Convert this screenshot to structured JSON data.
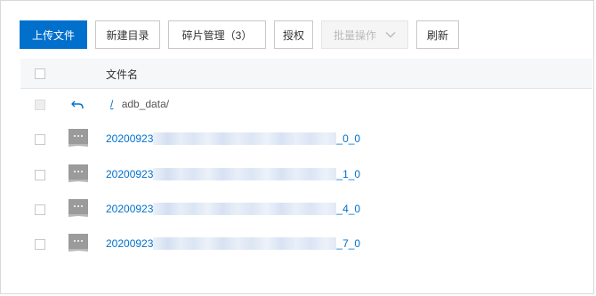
{
  "toolbar": {
    "upload_label": "上传文件",
    "new_dir_label": "新建目录",
    "fragment_label": "碎片管理（3）",
    "authorize_label": "授权",
    "batch_label": "批量操作",
    "refresh_label": "刷新"
  },
  "table": {
    "column_filename": "文件名"
  },
  "path": {
    "root": "/",
    "current": "adb_data/"
  },
  "files": [
    {
      "prefix": "20200923",
      "suffix": "_0_0"
    },
    {
      "prefix": "20200923",
      "suffix": "_1_0"
    },
    {
      "prefix": "20200923",
      "suffix": "_4_0"
    },
    {
      "prefix": "20200923",
      "suffix": "_7_0"
    }
  ],
  "colors": {
    "primary": "#0070cc",
    "link": "#0070cc",
    "header_bg": "#f6f7f9",
    "icon_gray": "#9b9b9b"
  },
  "icons": {
    "back": "back-arrow-icon",
    "file": "file-icon",
    "dropdown": "chevron-down-icon"
  }
}
